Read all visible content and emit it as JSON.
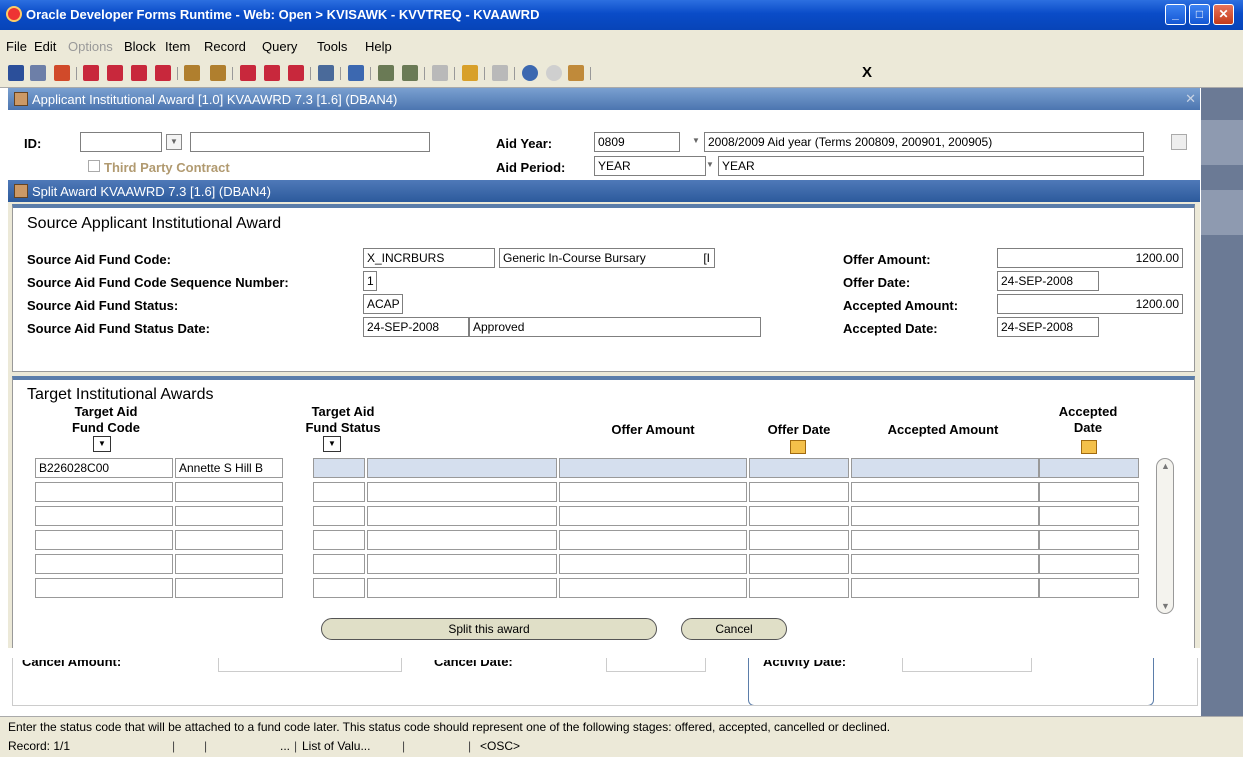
{
  "window": {
    "title": "Oracle Developer Forms Runtime - Web:  Open > KVISAWK - KVVTREQ - KVAAWRD"
  },
  "menu": [
    "File",
    "Edit",
    "Options",
    "Block",
    "Item",
    "Record",
    "Query",
    "Tools",
    "Help"
  ],
  "toolbar": {
    "exit_label": "X"
  },
  "form_window": {
    "title": "Applicant Institutional Award  [1.0]  KVAAWRD  7.3  [1.6]  (DBAN4)"
  },
  "key_block": {
    "id_label": "ID:",
    "id_value": "",
    "id_name": "",
    "third_party_label": "Third Party Contract",
    "aid_year_label": "Aid Year:",
    "aid_year_value": "0809",
    "aid_year_desc": "2008/2009 Aid year (Terms 200809, 200901, 200905)",
    "aid_period_label": "Aid Period:",
    "aid_period_value": "YEAR",
    "aid_period_desc": "YEAR"
  },
  "split_window": {
    "title": "Split Award  KVAAWRD  7.3  [1.6]  (DBAN4)",
    "source": {
      "heading": "Source Applicant Institutional Award",
      "fund_code_label": "Source Aid Fund Code:",
      "fund_code": "X_INCRBURS",
      "fund_desc": "Generic In-Course Bursary",
      "fund_desc_suffix": "[I",
      "seq_label": "Source Aid Fund Code Sequence Number:",
      "seq": "1",
      "status_label": "Source Aid Fund Status:",
      "status": "ACAP",
      "status_date_label": "Source Aid Fund Status Date:",
      "status_date": "24-SEP-2008",
      "status_desc": "Approved",
      "offer_amount_label": "Offer Amount:",
      "offer_amount": "1200.00",
      "offer_date_label": "Offer Date:",
      "offer_date": "24-SEP-2008",
      "accepted_amount_label": "Accepted Amount:",
      "accepted_amount": "1200.00",
      "accepted_date_label": "Accepted Date:",
      "accepted_date": "24-SEP-2008"
    },
    "target": {
      "heading": "Target Institutional Awards",
      "col_fund_code": "Target Aid\nFund Code",
      "col_fund_status": "Target Aid\nFund Status",
      "col_offer_amount": "Offer Amount",
      "col_offer_date": "Offer Date",
      "col_accepted_amount": "Accepted Amount",
      "col_accepted_date": "Accepted\nDate",
      "rows": [
        {
          "fund_code": "B226028C00",
          "fund_name": "Annette S Hill B",
          "status": "",
          "status_desc": "",
          "offer_amount": "",
          "offer_date": "",
          "accepted_amount": "",
          "accepted_date": ""
        },
        {
          "fund_code": "",
          "fund_name": "",
          "status": "",
          "status_desc": "",
          "offer_amount": "",
          "offer_date": "",
          "accepted_amount": "",
          "accepted_date": ""
        },
        {
          "fund_code": "",
          "fund_name": "",
          "status": "",
          "status_desc": "",
          "offer_amount": "",
          "offer_date": "",
          "accepted_amount": "",
          "accepted_date": ""
        },
        {
          "fund_code": "",
          "fund_name": "",
          "status": "",
          "status_desc": "",
          "offer_amount": "",
          "offer_date": "",
          "accepted_amount": "",
          "accepted_date": ""
        },
        {
          "fund_code": "",
          "fund_name": "",
          "status": "",
          "status_desc": "",
          "offer_amount": "",
          "offer_date": "",
          "accepted_amount": "",
          "accepted_date": ""
        },
        {
          "fund_code": "",
          "fund_name": "",
          "status": "",
          "status_desc": "",
          "offer_amount": "",
          "offer_date": "",
          "accepted_amount": "",
          "accepted_date": ""
        }
      ]
    },
    "split_button": "Split this award",
    "cancel_button": "Cancel"
  },
  "behind": {
    "cancel_amount_label": "Cancel Amount:",
    "cancel_date_label": "Cancel Date:",
    "activity_date_label": "Activity Date:"
  },
  "status_bar": {
    "message": "Enter the status code that will be attached to a fund code later. This status code should represent one of the following stages: offered, accepted, cancelled or declined.",
    "record": "Record: 1/1",
    "ellipsis": "...",
    "list_of_values": "List of Valu...",
    "osc": "<OSC>"
  }
}
